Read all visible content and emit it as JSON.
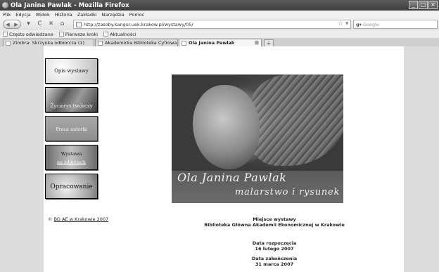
{
  "window": {
    "title": "Ola Janina Pawlak - Mozilla Firefox"
  },
  "menu": [
    "Plik",
    "Edycja",
    "Widok",
    "Historia",
    "Zakładki",
    "Narzędzia",
    "Pomoc"
  ],
  "nav": {
    "url": "http://zasoby.kangur.uek.krakow.pl/wystawy/05/",
    "search_placeholder": "Google"
  },
  "bookmarks": [
    "Często odwiedzane",
    "Pierwsze kroki",
    "Aktualności"
  ],
  "tabs": [
    {
      "label": "Zimbra: Skrzynka odbiorcza (1)"
    },
    {
      "label": "Akademicka Biblioteka Cyfrowa..."
    },
    {
      "label": "Ola Janina Pawlak"
    }
  ],
  "page": {
    "side_buttons": [
      "Opis wystawy",
      "Życiorys twórczy",
      "Prace autorki",
      "Wystawa",
      "na zdjęciach",
      "Opracowanie"
    ],
    "copyright_symbol": "©",
    "copyright_link": "BG AE w Krakowie 2007",
    "hero": {
      "line1": "Ola Janina Pawlak",
      "line2": "malarstwo i rysunek"
    },
    "venue_label": "Miejsce wystawy",
    "venue": "Biblioteka Główna Akademii Ekonomicznej w Krakowie",
    "start_label": "Data rozpoczęcia",
    "start_date": "16 lutego 2007",
    "end_label": "Data zakończenia",
    "end_date": "31 marca 2007"
  }
}
